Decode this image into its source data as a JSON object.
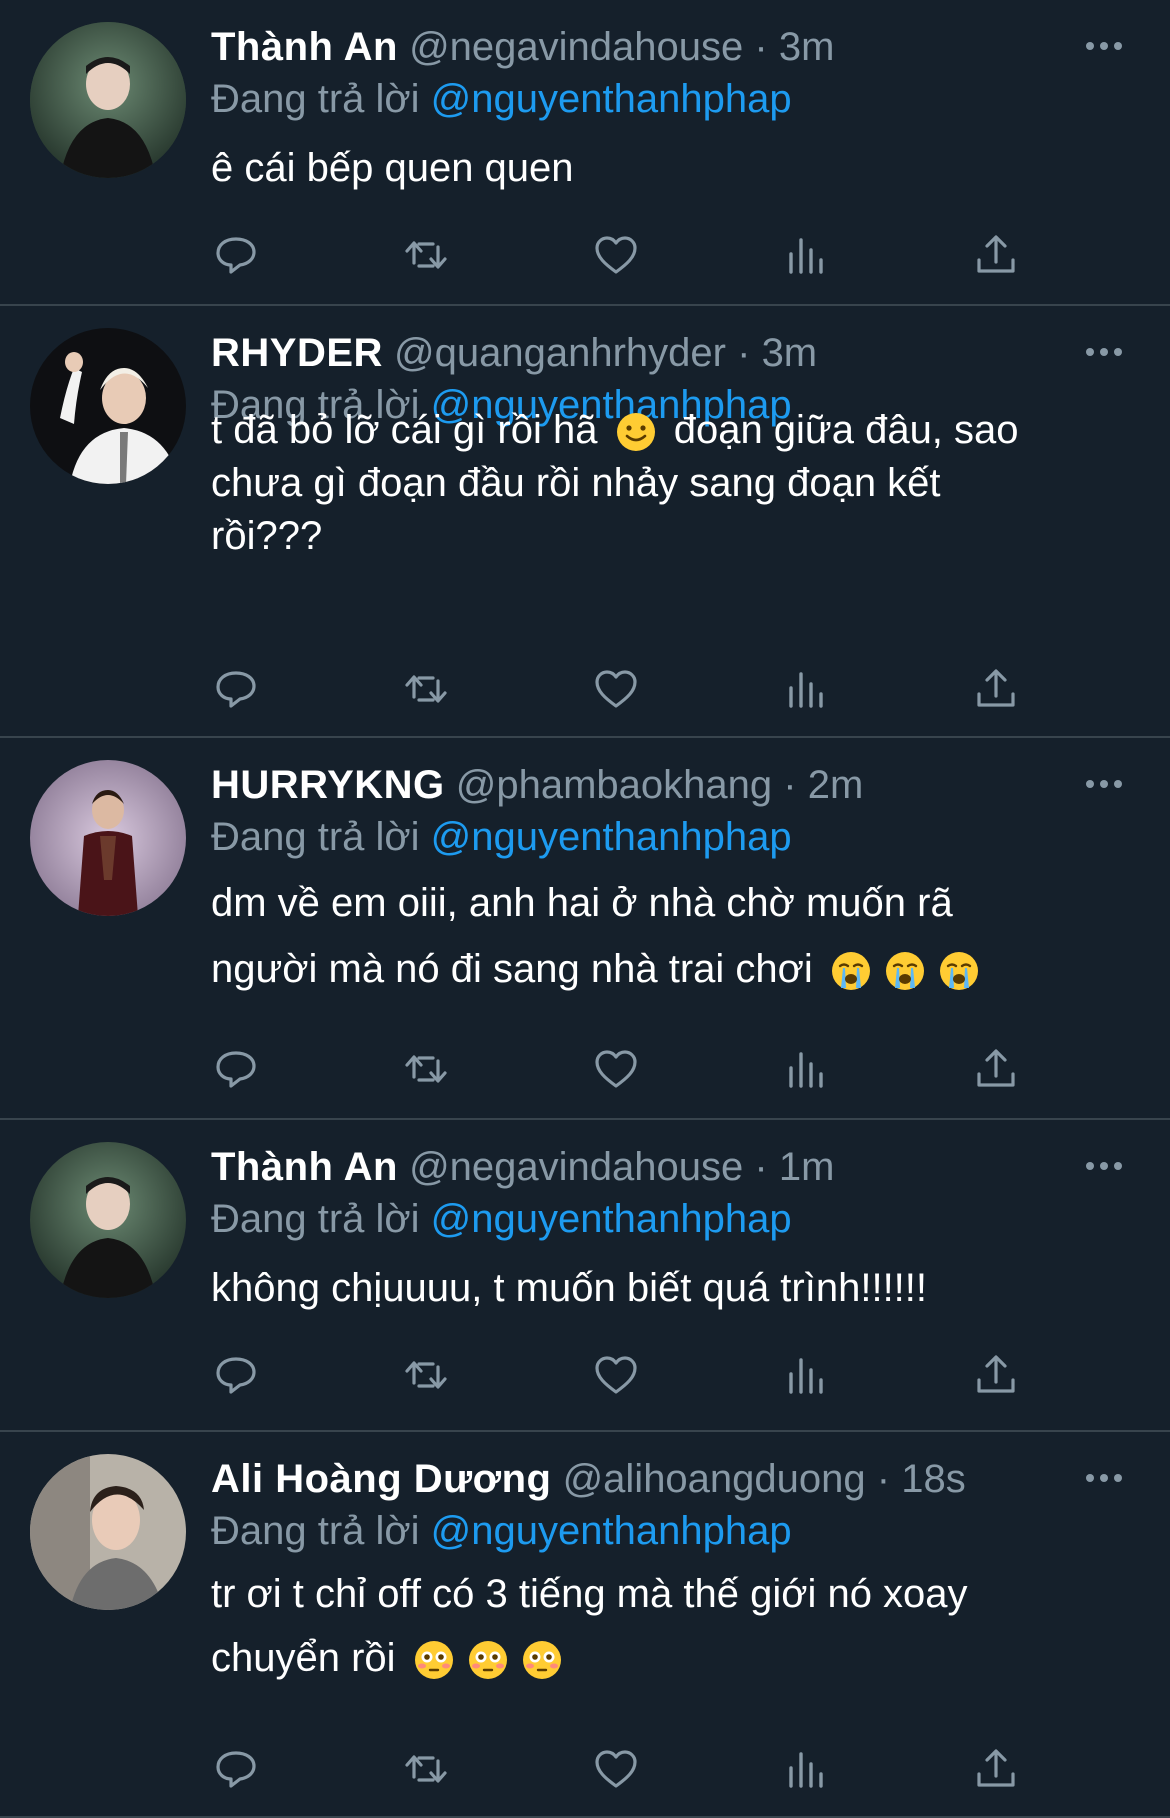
{
  "colors": {
    "background": "#15202b",
    "divider": "#38444d",
    "muted": "#8899a6",
    "accent": "#1d9bf0"
  },
  "icons": [
    "reply-icon",
    "retweet-icon",
    "like-icon",
    "views-icon",
    "share-icon",
    "more-icon"
  ],
  "tweets": [
    {
      "name": "Thành An",
      "handle": "@negavindahouse",
      "dot": "·",
      "time": "3m",
      "replying": "Đang trả lời",
      "mention": "@nguyenthanhphap",
      "line1": "ê cái bếp quen quen",
      "line2": "",
      "line3": ""
    },
    {
      "name": "RHYDER",
      "handle": "@quanganhrhyder",
      "dot": "·",
      "time": "3m",
      "replying": "Đang trả lời",
      "mention": "@nguyenthanhphap",
      "line1a": "t đã bỏ lỡ cái gì rồi hã",
      "line1b": "đoạn giữa đâu, sao",
      "line2": "chưa gì đoạn đầu rồi nhảy sang đoạn kết",
      "line3": "rồi???"
    },
    {
      "name": "HURRYKNG",
      "handle": "@phambaokhang",
      "dot": "·",
      "time": "2m",
      "replying": "Đang trả lời",
      "mention": "@nguyenthanhphap",
      "line1": "dm về em oiii, anh hai ở nhà chờ muốn rã",
      "line2": "người mà nó đi sang nhà trai chơi"
    },
    {
      "name": "Thành An",
      "handle": "@negavindahouse",
      "dot": "·",
      "time": "1m",
      "replying": "Đang trả lời",
      "mention": "@nguyenthanhphap",
      "line1": "không chịuuuu, t muốn biết quá trình!!!!!!"
    },
    {
      "name": "Ali Hoàng Dương",
      "handle": "@alihoangduong",
      "dot": "·",
      "time": "18s",
      "replying": "Đang trả lời",
      "mention": "@nguyenthanhphap",
      "line1": "tr ơi t chỉ off có 3 tiếng mà thế giới nó xoay",
      "line2": "chuyển rồi"
    }
  ]
}
